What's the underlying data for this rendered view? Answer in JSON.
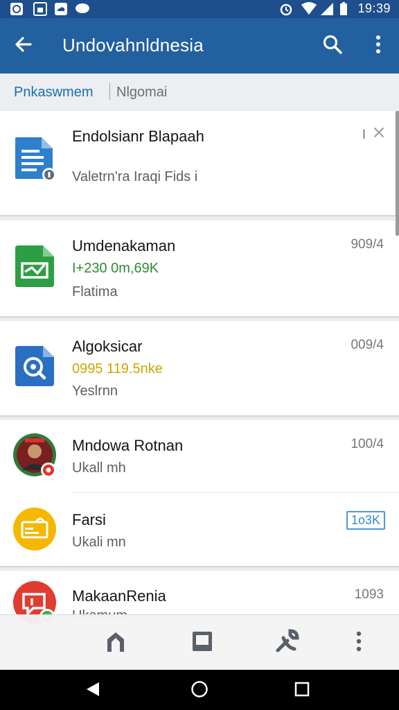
{
  "status_bar": {
    "time": "19:39",
    "icons": [
      "app-notification-icon",
      "image-notification-icon",
      "cloud-notification-icon",
      "chat-notification-icon",
      "alarm-icon",
      "wifi-icon",
      "signal-icon",
      "battery-icon"
    ]
  },
  "app_bar": {
    "title": "Undovahnldnesia",
    "back_icon": "arrow-back-icon",
    "search_icon": "search-icon",
    "menu_icon": "more-vert-icon"
  },
  "subheader": {
    "active_label": "Pnkaswmem",
    "other_label": "Nlgomai"
  },
  "cards": [
    {
      "title": "Endolsianr Blapaah",
      "line1": "Valetrn'ra Iraqi Fids i",
      "meta": "I",
      "icon": "document-icon",
      "color": "#2f80cc"
    },
    {
      "title": "Umdenakaman",
      "line1": "I+230 0m,69K",
      "line2": "Flatima",
      "meta": "909/4",
      "icon": "spreadsheet-icon",
      "color": "#2e9e44"
    },
    {
      "title": "Algoksicar",
      "line1": "0995 119.5nke",
      "line2": "Yeslrnn",
      "meta": "009/4",
      "icon": "search-app-icon",
      "color": "#2a6fc4"
    }
  ],
  "contacts": [
    {
      "name": "Mndowa Rotnan",
      "sub": "Ukall mh",
      "meta": "100/4",
      "icon": "avatar-photo",
      "color": "#7a1f1f"
    },
    {
      "name": "Farsi",
      "sub": "Ukali mn",
      "meta": "1o3K",
      "icon": "payment-card-icon",
      "color": "#f5b700"
    },
    {
      "name": "MakaanRenia",
      "sub": "Ukamum",
      "meta": "1093",
      "icon": "message-icon",
      "color": "#e23b30"
    }
  ],
  "toolbar": {
    "items": [
      "edit-shape-icon",
      "stop-square-icon",
      "tool-icon",
      "more-vert-icon"
    ]
  },
  "nav": {
    "items": [
      "back-triangle-icon",
      "home-circle-icon",
      "recents-square-icon"
    ]
  }
}
